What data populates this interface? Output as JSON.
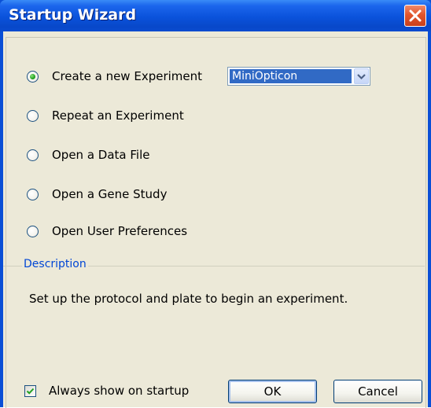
{
  "window": {
    "title": "Startup Wizard"
  },
  "options": [
    {
      "label": "Create a new Experiment",
      "checked": true
    },
    {
      "label": "Repeat an Experiment",
      "checked": false
    },
    {
      "label": "Open a Data File",
      "checked": false
    },
    {
      "label": "Open a Gene Study",
      "checked": false
    },
    {
      "label": "Open User Preferences",
      "checked": false
    }
  ],
  "instrument_select": {
    "value": "MiniOpticon"
  },
  "description": {
    "title": "Description",
    "text": "Set up the protocol and plate to begin an experiment."
  },
  "footer": {
    "always_show_label": "Always show on startup",
    "always_show_checked": true,
    "ok_label": "OK",
    "cancel_label": "Cancel"
  },
  "icons": {
    "close": "close-icon",
    "dropdown": "chevron-down-icon",
    "check": "check-icon"
  },
  "colors": {
    "titlebar": "#0a52db",
    "dialog_bg": "#ece9d8",
    "close_button": "#e2552c",
    "selection": "#316ac5",
    "group_title": "#0046d5"
  }
}
